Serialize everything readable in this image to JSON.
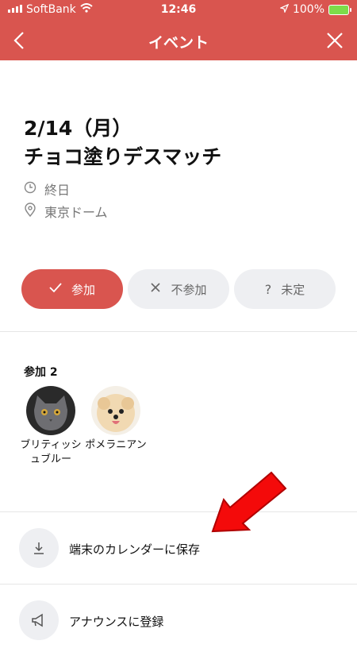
{
  "status_bar": {
    "carrier": "SoftBank",
    "time": "12:46",
    "battery": "100%"
  },
  "nav": {
    "title": "イベント"
  },
  "event": {
    "date": "2/14（月）",
    "title": "チョコ塗りデスマッチ",
    "time": "終日",
    "location": "東京ドーム"
  },
  "rsvp": {
    "join_label": "参加",
    "decline_label": "不参加",
    "undecided_label": "未定",
    "selected": "参加"
  },
  "participants": {
    "label": "参加 2",
    "members": [
      {
        "name": "ブリティッシュブルー"
      },
      {
        "name": "ポメラニアン"
      }
    ]
  },
  "actions": {
    "save_calendar": "端末のカレンダーに保存",
    "announce": "アナウンスに登録"
  },
  "colors": {
    "accent": "#d9554f",
    "chip_bg": "#eeeff2"
  }
}
